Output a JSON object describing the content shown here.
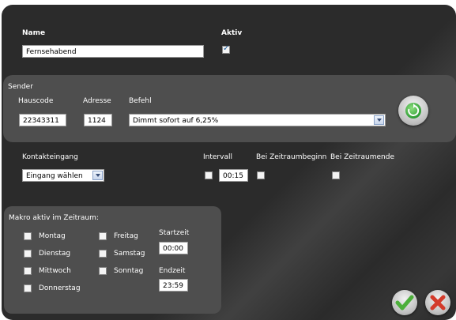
{
  "general": {
    "name_label": "Name",
    "name_value": "Fernsehabend",
    "aktiv_label": "Aktiv",
    "aktiv_checked": true
  },
  "sender": {
    "title": "Sender",
    "hauscode_label": "Hauscode",
    "hauscode_value": "22343311",
    "adresse_label": "Adresse",
    "adresse_value": "1124",
    "befehl_label": "Befehl",
    "befehl_value": "Dimmt sofort auf 6,25%",
    "refresh_icon": "refresh-icon"
  },
  "kontakt": {
    "label": "Kontakteingang",
    "select_value": "Eingang wählen",
    "intervall_label": "Intervall",
    "intervall_value": "00:15",
    "zeitraumbeginn_label": "Bei Zeitraumbeginn",
    "zeitraumende_label": "Bei Zeitraumende"
  },
  "makro": {
    "title": "Makro aktiv im Zeitraum:",
    "days_col1": [
      "Montag",
      "Dienstag",
      "Mittwoch",
      "Donnerstag"
    ],
    "days_col2": [
      "Freitag",
      "Samstag",
      "Sonntag"
    ],
    "startzeit_label": "Startzeit",
    "startzeit_value": "00:00",
    "endzeit_label": "Endzeit",
    "endzeit_value": "23:59"
  },
  "actions": {
    "ok_icon": "checkmark-icon",
    "cancel_icon": "close-icon"
  },
  "colors": {
    "background": "#2b2b2b",
    "panel": "#4e4e4e",
    "ok": "#4caf3a",
    "cancel": "#d33a2a",
    "refresh": "#3cb34a"
  }
}
